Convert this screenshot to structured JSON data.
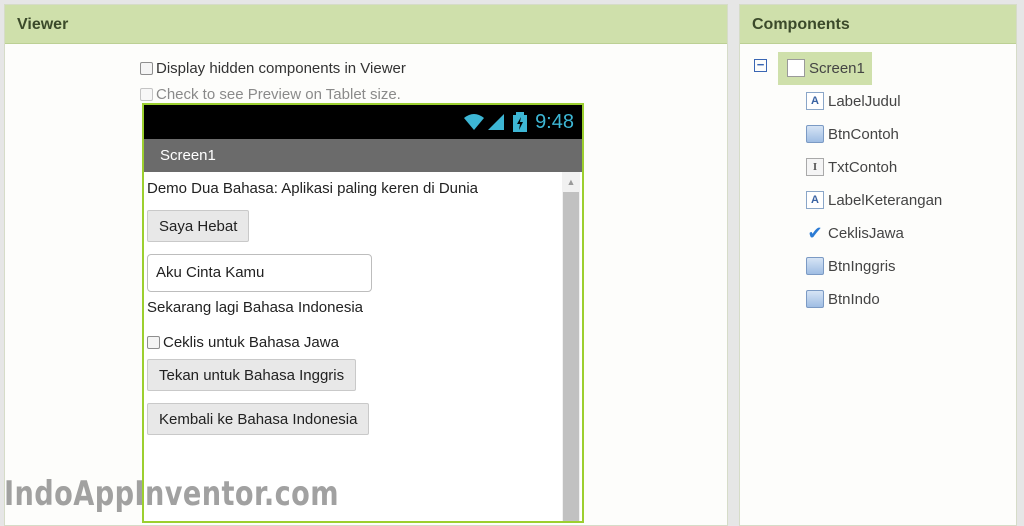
{
  "viewer": {
    "title": "Viewer",
    "show_hidden_label": "Display hidden components in Viewer",
    "tablet_preview_label": "Check to see Preview on Tablet size."
  },
  "phone": {
    "time": "9:48",
    "screen_title": "Screen1",
    "label_judul": "Demo Dua Bahasa: Aplikasi paling keren di Dunia",
    "btn_contoh": "Saya Hebat",
    "txt_contoh": "Aku Cinta Kamu",
    "label_keterangan": "Sekarang lagi Bahasa Indonesia",
    "ceklis_jawa": "Ceklis untuk Bahasa Jawa",
    "btn_inggris": "Tekan untuk Bahasa Inggris",
    "btn_indo": "Kembali ke Bahasa Indonesia"
  },
  "components": {
    "title": "Components",
    "collapse_symbol": "−",
    "root": "Screen1",
    "items": [
      {
        "name": "LabelJudul",
        "icon": "label-icon"
      },
      {
        "name": "BtnContoh",
        "icon": "button-icon"
      },
      {
        "name": "TxtContoh",
        "icon": "textbox-icon"
      },
      {
        "name": "LabelKeterangan",
        "icon": "label-icon"
      },
      {
        "name": "CeklisJawa",
        "icon": "checkbox-icon"
      },
      {
        "name": "BtnInggris",
        "icon": "button-icon"
      },
      {
        "name": "BtnIndo",
        "icon": "button-icon"
      }
    ]
  },
  "watermark": "IndoAppInventor.com",
  "colors": {
    "header_bg": "#cfe0ab",
    "phone_border": "#9ccf2f",
    "status_icons": "#3db6d4",
    "titlebar": "#6b6b6b"
  }
}
